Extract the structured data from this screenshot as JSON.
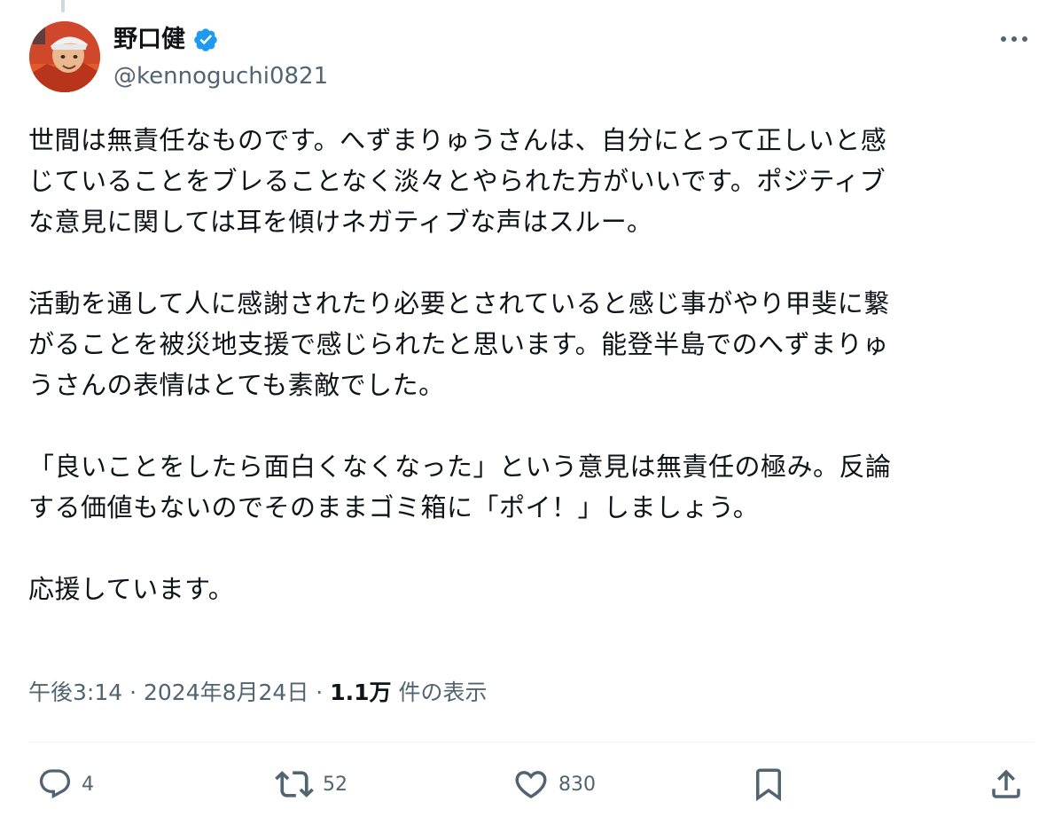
{
  "tweet": {
    "author": {
      "display_name": "野口健",
      "handle": "@kennoguchi0821",
      "verified": true
    },
    "paragraphs": [
      {
        "lines": [
          "世間は無責任なものです。へずまりゅうさんは、自分にとって正しいと感",
          "じていることをブレることなく淡々とやられた方がいいです。ポジティブ",
          "な意見に関しては耳を傾けネガティブな声はスルー。"
        ]
      },
      {
        "lines": [
          "活動を通して人に感謝されたり必要とされていると感じ事がやり甲斐に繋",
          "がることを被災地支援で感じられたと思います。能登半島でのへずまりゅ",
          "うさんの表情はとても素敵でした。"
        ]
      },
      {
        "lines": [
          "「良いことをしたら面白くなくなった」という意見は無責任の極み。反論",
          "する価値もないのでそのままゴミ箱に「ポイ！」しましょう。"
        ]
      },
      {
        "lines": [
          "応援しています。"
        ]
      }
    ],
    "meta": {
      "time": "午後3:14",
      "separator": "·",
      "date": "2024年8月24日",
      "views_count": "1.1万",
      "views_label": "件の表示"
    },
    "actions": {
      "reply_count": "4",
      "retweet_count": "52",
      "like_count": "830"
    }
  },
  "icons": {
    "verified": "verified-badge-icon",
    "more": "more-options-icon",
    "reply": "reply-icon",
    "retweet": "retweet-icon",
    "like": "heart-icon",
    "bookmark": "bookmark-icon",
    "share": "share-icon"
  },
  "colors": {
    "text": "#0f1419",
    "secondary": "#536471",
    "verified": "#1d9bf0",
    "divider": "#eff3f4"
  }
}
